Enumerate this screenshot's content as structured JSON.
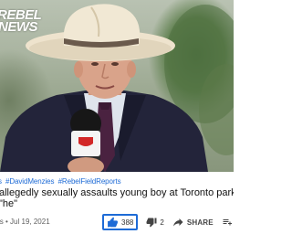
{
  "video": {
    "watermark_line1": "REBEL",
    "watermark_line2": "NEWS"
  },
  "hashtags": [
    "s",
    "#DavidMenzies",
    "#RebelFieldReports"
  ],
  "title": {
    "line1": "allegedly sexually assaults young boy at Toronto park — but \"s",
    "line2": "\"he\""
  },
  "meta": {
    "channel_fragment": "ws",
    "date": "Jul 19, 2021"
  },
  "actions": {
    "like_count": "388",
    "dislike_count": "2",
    "share_label": "SHARE",
    "save_label": "S"
  },
  "colors": {
    "accent": "#1e6bd6",
    "hashtag": "#1e6bd6"
  }
}
